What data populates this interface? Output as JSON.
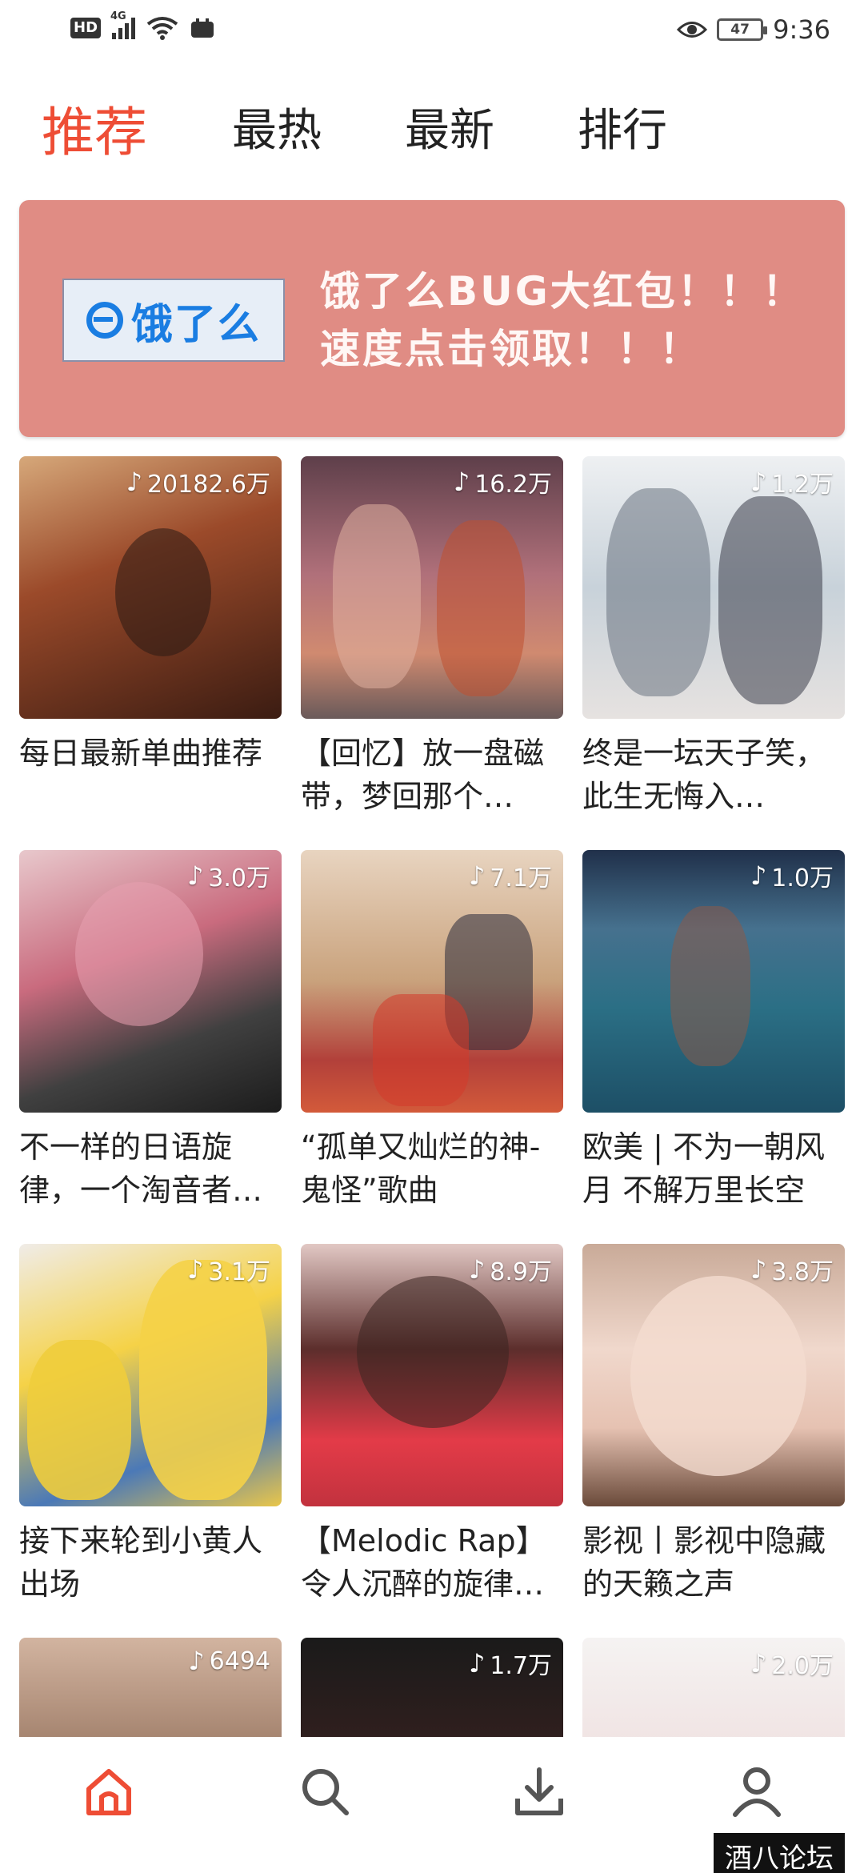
{
  "status_bar": {
    "hd": "HD",
    "network": "4G",
    "battery": "47",
    "time": "9:36"
  },
  "tabs": [
    {
      "label": "推荐",
      "active": true
    },
    {
      "label": "最热",
      "active": false
    },
    {
      "label": "最新",
      "active": false
    },
    {
      "label": "排行",
      "active": false
    }
  ],
  "banner": {
    "logo_text": "饿了么",
    "line1": "饿了么BUG大红包！！！",
    "line2": "速度点击领取！！！",
    "bg_color": "#e08c84"
  },
  "accent_color": "#ee4d35",
  "playlists": [
    {
      "count": "20182.6万",
      "title": "每日最新单曲推荐"
    },
    {
      "count": "16.2万",
      "title": "【回忆】放一盘磁带，梦回那个…"
    },
    {
      "count": "1.2万",
      "title": "终是一坛天子笑，此生无悔入…"
    },
    {
      "count": "3.0万",
      "title": "不一样的日语旋律，一个淘音者…"
    },
    {
      "count": "7.1万",
      "title": "“孤单又灿烂的神-鬼怪”歌曲"
    },
    {
      "count": "1.0万",
      "title": "欧美 | 不为一朝风月 不解万里长空"
    },
    {
      "count": "3.1万",
      "title": "接下来轮到小黄人出场"
    },
    {
      "count": "8.9万",
      "title": "【Melodic Rap】令人沉醉的旋律…"
    },
    {
      "count": "3.8万",
      "title": "影视丨影视中隐藏的天籁之声"
    },
    {
      "count": "6494",
      "title": ""
    },
    {
      "count": "1.7万",
      "title": ""
    },
    {
      "count": "2.0万",
      "title": ""
    }
  ],
  "bottom_nav": [
    {
      "icon": "home-icon",
      "active": true
    },
    {
      "icon": "search-icon",
      "active": false
    },
    {
      "icon": "download-icon",
      "active": false
    },
    {
      "icon": "profile-icon",
      "active": false
    }
  ],
  "watermark": "酒八论坛"
}
